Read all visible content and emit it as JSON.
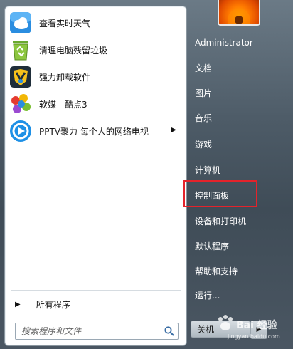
{
  "programs": [
    {
      "label": "查看实时天气",
      "icon": "weather-icon"
    },
    {
      "label": "清理电脑残留垃圾",
      "icon": "recycle-bin-icon"
    },
    {
      "label": "强力卸载软件",
      "icon": "uninstaller-icon"
    },
    {
      "label": "软媒 - 酷点3",
      "icon": "kudian-icon"
    },
    {
      "label": "PPTV聚力 每个人的网络电视",
      "icon": "pptv-icon",
      "has_submenu": true
    }
  ],
  "all_programs_label": "所有程序",
  "search": {
    "placeholder": "搜索程序和文件"
  },
  "right_items": [
    "Administrator",
    "文档",
    "图片",
    "音乐",
    "游戏",
    "计算机",
    "控制面板",
    "设备和打印机",
    "默认程序",
    "帮助和支持",
    "运行..."
  ],
  "shutdown_label": "关机",
  "watermark": {
    "brand": "Bai 经验",
    "url": "jingyan.baidu.com"
  },
  "colors": {
    "highlight": "#e4232b"
  }
}
